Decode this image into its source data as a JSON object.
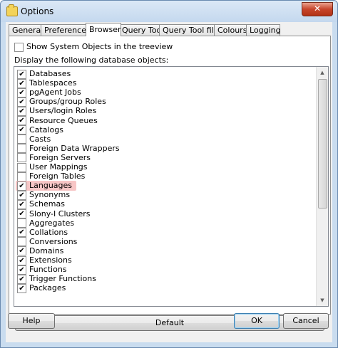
{
  "window": {
    "title": "Options",
    "close_label": "✕"
  },
  "tabs": [
    "General",
    "Preferences",
    "Browser",
    "Query Tool",
    "Query Tool files",
    "Colours",
    "Logging"
  ],
  "active_tab": "Browser",
  "browser": {
    "show_system_objects_label": "Show System Objects in the treeview",
    "show_system_objects_checked": false,
    "display_label": "Display the following database objects:",
    "items": [
      {
        "label": "Databases",
        "checked": true
      },
      {
        "label": "Tablespaces",
        "checked": true
      },
      {
        "label": "pgAgent Jobs",
        "checked": true
      },
      {
        "label": "Groups/group Roles",
        "checked": true
      },
      {
        "label": "Users/login Roles",
        "checked": true
      },
      {
        "label": "Resource Queues",
        "checked": true
      },
      {
        "label": "Catalogs",
        "checked": true
      },
      {
        "label": "Casts",
        "checked": false
      },
      {
        "label": "Foreign Data Wrappers",
        "checked": false
      },
      {
        "label": "Foreign Servers",
        "checked": false
      },
      {
        "label": "User Mappings",
        "checked": false
      },
      {
        "label": "Foreign Tables",
        "checked": false
      },
      {
        "label": "Languages",
        "checked": true,
        "highlighted": true
      },
      {
        "label": "Synonyms",
        "checked": true
      },
      {
        "label": "Schemas",
        "checked": true
      },
      {
        "label": "Slony-I Clusters",
        "checked": true
      },
      {
        "label": "Aggregates",
        "checked": false
      },
      {
        "label": "Collations",
        "checked": true
      },
      {
        "label": "Conversions",
        "checked": false
      },
      {
        "label": "Domains",
        "checked": true
      },
      {
        "label": "Extensions",
        "checked": true
      },
      {
        "label": "Functions",
        "checked": true
      },
      {
        "label": "Trigger Functions",
        "checked": true
      },
      {
        "label": "Packages",
        "checked": true
      }
    ],
    "default_button": "Default"
  },
  "footer": {
    "help_button": "Help",
    "ok_button": "OK",
    "cancel_button": "Cancel"
  },
  "colors": {
    "highlight": "#f7c6c6",
    "default_button_border": "#3c7fb1"
  }
}
